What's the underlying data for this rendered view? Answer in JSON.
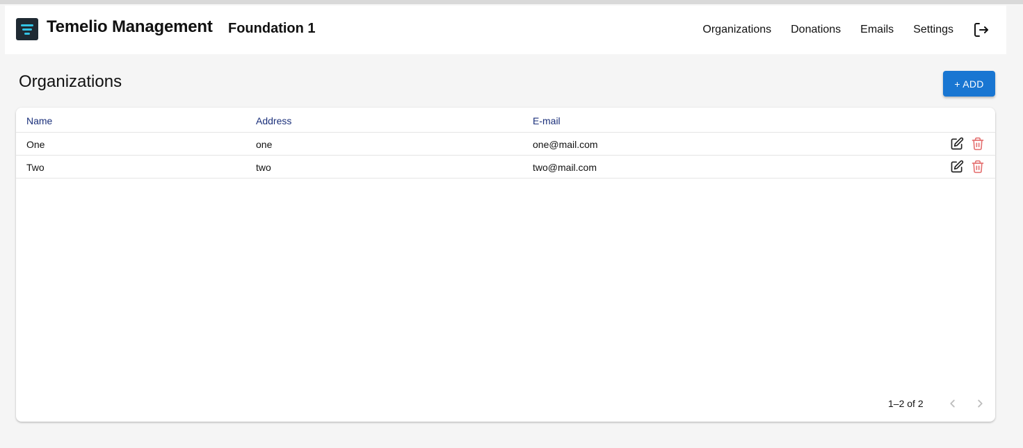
{
  "header": {
    "brand": "Temelio Management",
    "foundation": "Foundation 1",
    "nav": [
      {
        "label": "Organizations"
      },
      {
        "label": "Donations"
      },
      {
        "label": "Emails"
      },
      {
        "label": "Settings"
      }
    ],
    "logout_icon": "logout-icon",
    "logo_icon": "temelio-logo-icon"
  },
  "page": {
    "title": "Organizations",
    "add_label": "+ ADD"
  },
  "table": {
    "columns": [
      "Name",
      "Address",
      "E-mail"
    ],
    "rows": [
      {
        "name": "One",
        "address": "one",
        "email": "one@mail.com"
      },
      {
        "name": "Two",
        "address": "two",
        "email": "two@mail.com"
      }
    ],
    "pagination": {
      "text": "1–2 of 2"
    }
  },
  "colors": {
    "accent": "#1976d2",
    "header_text": "#1a2f7a",
    "delete": "#e57373"
  }
}
